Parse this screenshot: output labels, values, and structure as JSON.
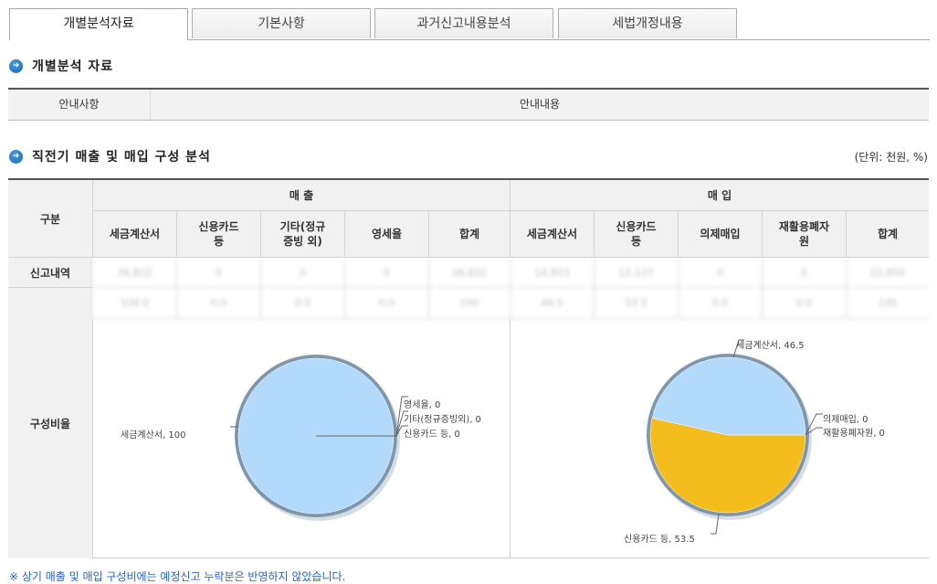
{
  "tabs": [
    "개별분석자료",
    "기본사항",
    "과거신고내용분석",
    "세법개정내용"
  ],
  "section1": {
    "title": "개별분석 자료"
  },
  "info_table": {
    "col1": "안내사항",
    "col2": "안내내용"
  },
  "section2": {
    "title": "직전기 매출 및 매입 구성 분석",
    "unit": "(단위: 천원, %)"
  },
  "table": {
    "row_header": "구분",
    "sales_header": "매 출",
    "purchase_header": "매 입",
    "sales_cols": [
      "세금계산서",
      "신용카드\n등",
      "기타(정규\n증빙 외)",
      "영세율",
      "합계"
    ],
    "purchase_cols": [
      "세금계산서",
      "신용카드\n등",
      "의제매입",
      "재활용폐자\n원",
      "합계"
    ],
    "row1_label": "신고내역",
    "row1_values": [
      "26,822",
      "0",
      "0",
      "0",
      "26,822",
      "14,923",
      "12,137",
      "0",
      "0",
      "22,850"
    ],
    "row2_values": [
      "100.0",
      "0.0",
      "0.0",
      "0.0",
      "100",
      "46.5",
      "53.5",
      "0.0",
      "0.0",
      "100"
    ],
    "ratio_label": "구성비율"
  },
  "pie_sales": {
    "labels": [
      "세금계산서, 100",
      "영세율, 0",
      "기타(정규증빙외), 0",
      "신용카드 등, 0"
    ]
  },
  "pie_purchase": {
    "labels": [
      "세금계산서, 46.5",
      "의제매입, 0",
      "재활용폐자원, 0",
      "신용카드 등, 53.5"
    ]
  },
  "chart_data": [
    {
      "type": "pie",
      "slices": [
        {
          "name": "세금계산서",
          "value": 100,
          "color": "#b3d9fb"
        },
        {
          "name": "영세율",
          "value": 0
        },
        {
          "name": "기타(정규증빙외)",
          "value": 0
        },
        {
          "name": "신용카드 등",
          "value": 0
        }
      ]
    },
    {
      "type": "pie",
      "slices": [
        {
          "name": "세금계산서",
          "value": 46.5,
          "color": "#b3d9fb"
        },
        {
          "name": "신용카드 등",
          "value": 53.5,
          "color": "#f4bd1d"
        },
        {
          "name": "의제매입",
          "value": 0
        },
        {
          "name": "재활용폐자원",
          "value": 0
        }
      ]
    }
  ],
  "footnote": "※ 상기 매출 및 매입 구성비에는 예정신고 누락분은 반영하지 않았습니다."
}
